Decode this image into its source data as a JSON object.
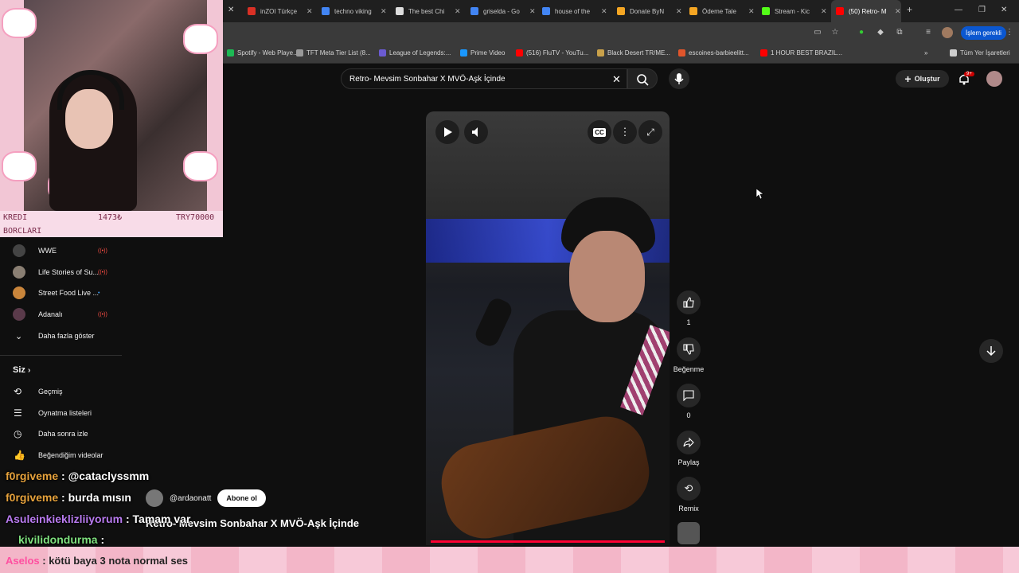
{
  "tabs": [
    {
      "title": "inZOI Türkçe",
      "color": "#d93025"
    },
    {
      "title": "techno viking",
      "color": "#4285f4"
    },
    {
      "title": "The best Chi",
      "color": "#dddddd"
    },
    {
      "title": "griselda - Go",
      "color": "#4285f4"
    },
    {
      "title": "house of the",
      "color": "#4285f4"
    },
    {
      "title": "Donate ByN",
      "color": "#f5a623"
    },
    {
      "title": "Ödeme Tale",
      "color": "#f5a623"
    },
    {
      "title": "Stream - Kic",
      "color": "#53fc18"
    },
    {
      "title": "(50) Retro- M",
      "color": "#ff0000"
    }
  ],
  "browser": {
    "action_button": "İşlem gerekli"
  },
  "bookmarks": [
    {
      "label": "Spotify - Web Playe...",
      "color": "#1db954"
    },
    {
      "label": "TFT Meta Tier List (8...",
      "color": "#999999"
    },
    {
      "label": "League of Legends:...",
      "color": "#6b5bd2"
    },
    {
      "label": "Prime Video",
      "color": "#1a98ff"
    },
    {
      "label": "(516) FluTV - YouTu...",
      "color": "#ff0000"
    },
    {
      "label": "Black Desert TR/ME...",
      "color": "#c9a14a"
    },
    {
      "label": "escoines-barbieelitt...",
      "color": "#e0552b"
    },
    {
      "label": "1 HOUR BEST BRAZIL...",
      "color": "#ff0000"
    },
    {
      "label": "Tüm Yer İşaretleri",
      "color": "#cccccc"
    }
  ],
  "youtube": {
    "search_value": "Retro- Mevsim Sonbahar X MVÖ-Aşk İçinde",
    "create_label": "Oluştur",
    "notif_count": "9+"
  },
  "overlay": {
    "kredi_label": "KREDI",
    "borclari_label": "BORCLARI",
    "balance": "1473₺",
    "target": "TRY70000"
  },
  "sidebar": {
    "subscriptions": [
      {
        "label": "WWE",
        "icon": "#444444",
        "live": true
      },
      {
        "label": "Life Stories of Su...",
        "icon": "#8a7f73",
        "live": true
      },
      {
        "label": "Street Food Live ...",
        "icon": "#c9853b",
        "live": false
      },
      {
        "label": "Adanalı",
        "icon": "#5a3a4a",
        "live": true
      }
    ],
    "show_more": "Daha fazla göster",
    "siz_header": "Siz",
    "siz_items": [
      "Geçmiş",
      "Oynatma listeleri",
      "Daha sonra izle",
      "Beğendiğim videolar"
    ]
  },
  "video": {
    "title": "Retro- Mevsim Sonbahar X  MVÖ-Aşk İçinde",
    "channel": "@ardaonatt",
    "subscribe_label": "Abone ol"
  },
  "actions": {
    "like_count": "1",
    "dislike_label": "Beğenme",
    "comment_count": "0",
    "share_label": "Paylaş",
    "remix_label": "Remix"
  },
  "chat": [
    {
      "user": "f0rgiveme",
      "sep": " : ",
      "text": "@cataclyssmm",
      "color": "#e6a23c"
    },
    {
      "user": "f0rgiveme",
      "sep": " : ",
      "text": "burda mısın",
      "color": "#e6a23c"
    },
    {
      "user": "Asuleinkieklizliiyorum",
      "sep": " : ",
      "text": "Tamam var",
      "color": "#b97bf0"
    },
    {
      "user": "kivilidondurma",
      "sep": " : ",
      "text": "",
      "color": "#7ee07e"
    },
    {
      "user": "Aselos",
      "sep": " : ",
      "text": "kötü baya 3 nota normal ses",
      "color": "#ff4fa0"
    }
  ]
}
